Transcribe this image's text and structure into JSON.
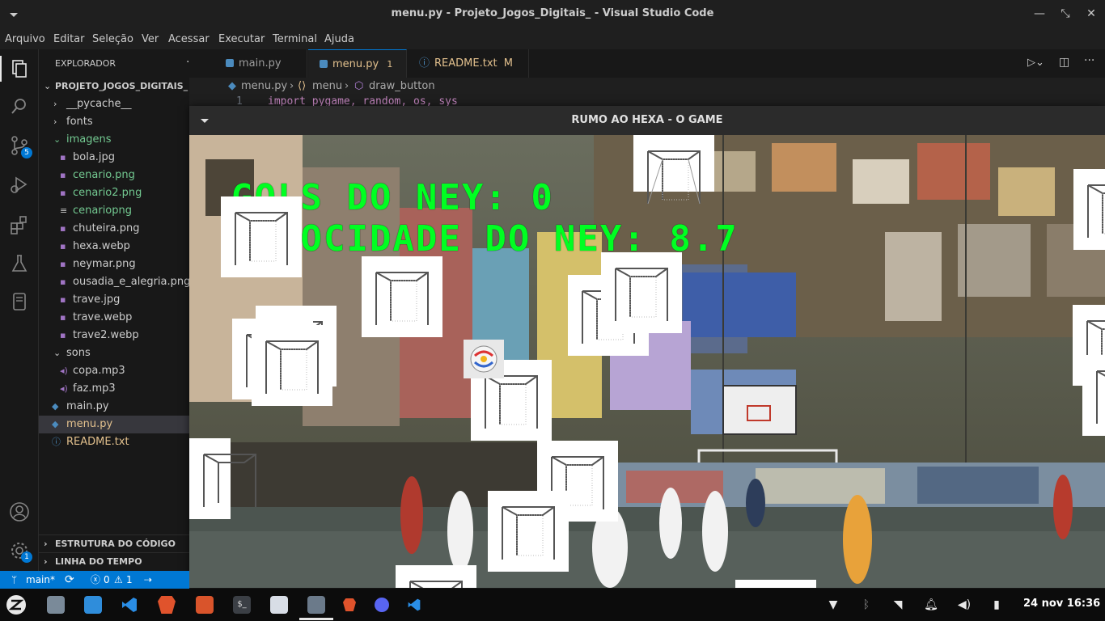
{
  "window": {
    "title": "menu.py - Projeto_Jogos_Digitais_ - Visual Studio Code"
  },
  "menubar": [
    "Arquivo",
    "Editar",
    "Seleção",
    "Ver",
    "Acessar",
    "Executar",
    "Terminal",
    "Ajuda"
  ],
  "activity": {
    "scm_badge": "5",
    "settings_badge": "1"
  },
  "sidebar": {
    "header": "EXPLORADOR",
    "project": "PROJETO_JOGOS_DIGITAIS_",
    "tree": [
      {
        "label": "__pycache__",
        "type": "folder"
      },
      {
        "label": "fonts",
        "type": "folder"
      },
      {
        "label": "imagens",
        "type": "folder-open"
      },
      {
        "label": "bola.jpg",
        "type": "file"
      },
      {
        "label": "cenario.png",
        "type": "file-img"
      },
      {
        "label": "cenario2.png",
        "type": "file-img"
      },
      {
        "label": "cenariopng",
        "type": "file-text"
      },
      {
        "label": "chuteira.png",
        "type": "file-img"
      },
      {
        "label": "hexa.webp",
        "type": "file-img"
      },
      {
        "label": "neymar.png",
        "type": "file-img"
      },
      {
        "label": "ousadia_e_alegria.png",
        "type": "file-img"
      },
      {
        "label": "trave.jpg",
        "type": "file-img"
      },
      {
        "label": "trave.webp",
        "type": "file-img"
      },
      {
        "label": "trave2.webp",
        "type": "file-img"
      },
      {
        "label": "sons",
        "type": "folder-open"
      },
      {
        "label": "copa.mp3",
        "type": "file-audio"
      },
      {
        "label": "faz.mp3",
        "type": "file-audio"
      },
      {
        "label": "main.py",
        "type": "file-py"
      },
      {
        "label": "menu.py",
        "type": "file-py"
      },
      {
        "label": "README.txt",
        "type": "file-info"
      }
    ],
    "outline": "ESTRUTURA DO CÓDIGO",
    "timeline": "LINHA DO TEMPO"
  },
  "tabs": [
    {
      "label": "main.py",
      "badge": ""
    },
    {
      "label": "menu.py",
      "badge": "1"
    },
    {
      "label": "README.txt",
      "badge": "M"
    }
  ],
  "breadcrumb": {
    "file": "menu.py",
    "symbol1": "menu",
    "symbol2": "draw_button"
  },
  "editor": {
    "line_number": "1",
    "line_text": "import pygame, random, os, sys"
  },
  "game": {
    "title": "RUMO AO HEXA - O GAME",
    "hud_goals": "GOLS DO NEY: 0",
    "hud_speed": "VELOCIDADE DO NEY: 8.7"
  },
  "statusbar": {
    "branch": "main*",
    "errors": "0",
    "warnings": "1"
  },
  "taskbar": {
    "clock": "24 nov 16:36"
  }
}
